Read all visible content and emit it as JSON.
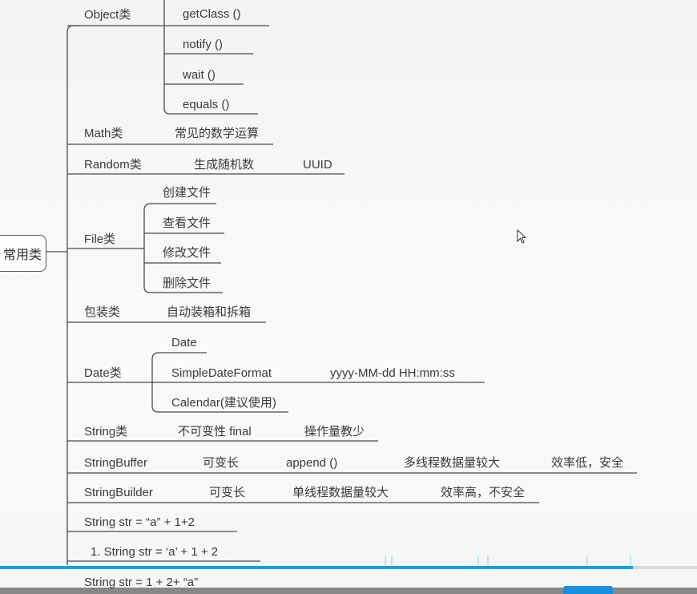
{
  "root": "常用类",
  "branches": {
    "object": "Object类",
    "object_children": [
      "getClass  ()",
      "notify  ()",
      "wait  ()",
      "equals  ()"
    ],
    "math": "Math类",
    "math_children": [
      "常见的数学运算"
    ],
    "random": "Random类",
    "random_children": [
      "生成随机数",
      "UUID"
    ],
    "file": "File类",
    "file_children": [
      "创建文件",
      "查看文件",
      "修改文件",
      "删除文件"
    ],
    "wrapper": "包装类",
    "wrapper_children": [
      "自动装箱和拆箱"
    ],
    "date": "Date类",
    "date_children": [
      "Date",
      "SimpleDateFormat",
      "Calendar(建议使用)"
    ],
    "date_format": "yyyy-MM-dd HH:mm:ss",
    "string": "String类",
    "string_children": [
      "不可变性 final",
      "操作量教少"
    ],
    "stringbuffer": "StringBuffer",
    "stringbuffer_children": [
      "可变长",
      "append  ()",
      "多线程数据量较大",
      "效率低，安全"
    ],
    "stringbuilder": "StringBuilder",
    "stringbuilder_children": [
      "可变长",
      "单线程数据量较大",
      "效率高，不安全"
    ],
    "str1": "String str =   “a”  + 1+2",
    "str2": "1. String str =   ‘a’   + 1 + 2",
    "str3": "String str = 1 + 2+   “a”"
  },
  "colors": {
    "line": "#4a4a4a",
    "progress": "#0aa0e8"
  },
  "icons": {
    "cursor": "mouse-pointer-icon"
  }
}
